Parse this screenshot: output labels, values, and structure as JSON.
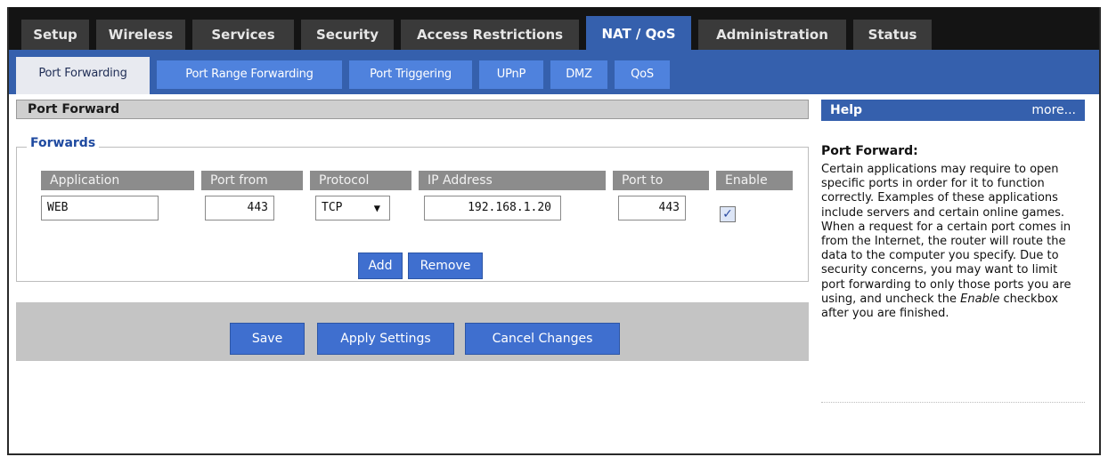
{
  "nav": {
    "main_tabs": [
      {
        "label": "Setup"
      },
      {
        "label": "Wireless"
      },
      {
        "label": "Services"
      },
      {
        "label": "Security"
      },
      {
        "label": "Access Restrictions"
      },
      {
        "label": "NAT / QoS"
      },
      {
        "label": "Administration"
      },
      {
        "label": "Status"
      }
    ],
    "active_main_tab": "NAT / QoS",
    "sub_tabs": [
      {
        "label": "Port Forwarding"
      },
      {
        "label": "Port Range Forwarding"
      },
      {
        "label": "Port Triggering"
      },
      {
        "label": "UPnP"
      },
      {
        "label": "DMZ"
      },
      {
        "label": "QoS"
      }
    ],
    "active_sub_tab": "Port Forwarding"
  },
  "section": {
    "title": "Port Forward",
    "fieldset_legend": "Forwards"
  },
  "table": {
    "columns": [
      "Application",
      "Port from",
      "Protocol",
      "IP Address",
      "Port to",
      "Enable"
    ],
    "rows": [
      {
        "application": "WEB",
        "port_from": "443",
        "protocol": "TCP",
        "ip_address": "192.168.1.20",
        "port_to": "443",
        "enable": true
      }
    ]
  },
  "buttons": {
    "add": "Add",
    "remove": "Remove",
    "save": "Save",
    "apply": "Apply Settings",
    "cancel": "Cancel Changes"
  },
  "help": {
    "header": "Help",
    "more": "more...",
    "title": "Port Forward:",
    "text_part1": "Certain applications may require to open specific ports in order for it to function correctly. Examples of these applications include servers and certain online games. When a request for a certain port comes in from the Internet, the router will route the data to the computer you specify. Due to security concerns, you may want to limit port forwarding to only those ports you are using, and uncheck the ",
    "text_emph": "Enable",
    "text_part2": " checkbox after you are finished."
  },
  "colors": {
    "accent_blue": "#3560ad",
    "subtab_blue": "#4f82dd",
    "button_blue": "#3f6fcf",
    "legend_blue": "#1f4aa0"
  }
}
